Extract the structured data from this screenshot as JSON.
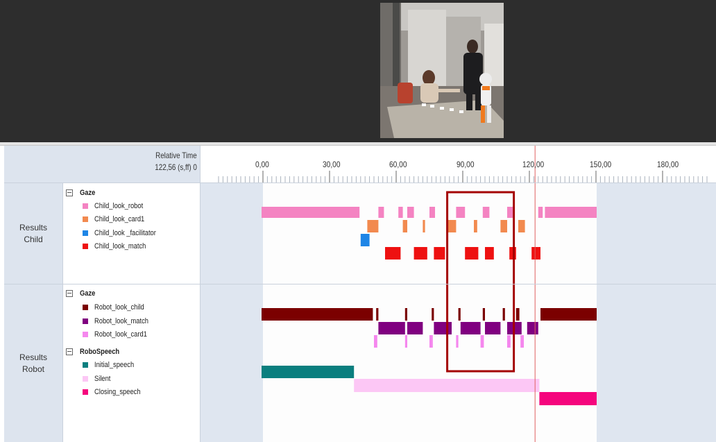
{
  "ruler": {
    "relative_time_label": "Relative Time",
    "time_format_label": "122,56 (s,ff) 0",
    "ticks": [
      "0,00",
      "30,00",
      "60,00",
      "90,00",
      "120,00",
      "150,00",
      "180,00"
    ]
  },
  "groups": [
    {
      "label_line1": "Results",
      "label_line2": "Child",
      "sections": [
        {
          "title": "Gaze",
          "tiers": [
            {
              "name": "Child_look_robot",
              "color": "#f483c2"
            },
            {
              "name": "Child_look_card1",
              "color": "#f28a4f"
            },
            {
              "name": "Child_look _facilitator",
              "color": "#1e85e6"
            },
            {
              "name": "Child_look_match",
              "color": "#ee1111"
            }
          ]
        }
      ]
    },
    {
      "label_line1": "Results",
      "label_line2": "Robot",
      "sections": [
        {
          "title": "Gaze",
          "tiers": [
            {
              "name": "Robot_look_child",
              "color": "#7b0000"
            },
            {
              "name": "Robot_look_match",
              "color": "#800080"
            },
            {
              "name": "Robot_look_card1",
              "color": "#f587ee"
            }
          ]
        },
        {
          "title": "RoboSpeech",
          "tiers": [
            {
              "name": "Initial_speech",
              "color": "#0a7f7f"
            },
            {
              "name": "Silent",
              "color": "#fcc7f5"
            },
            {
              "name": "Closing_speech",
              "color": "#f5057d"
            }
          ]
        }
      ]
    }
  ],
  "timeline": {
    "media_end": 150,
    "cursor_time": 122.56,
    "cursor_color": "#e06060",
    "highlight_range": [
      83,
      113
    ],
    "highlight_color": "#a40000"
  },
  "annotations": {
    "Child_look_robot": [
      [
        -1,
        43.5
      ],
      [
        52,
        54.5
      ],
      [
        61,
        63
      ],
      [
        65,
        68
      ],
      [
        75,
        77.5
      ],
      [
        87,
        91
      ],
      [
        99,
        102
      ],
      [
        110,
        112.5
      ],
      [
        124,
        126
      ],
      [
        127,
        151
      ]
    ],
    "Child_look_card1": [
      [
        47,
        52
      ],
      [
        63,
        65
      ],
      [
        72,
        73
      ],
      [
        83,
        87
      ],
      [
        95,
        96.5
      ],
      [
        107,
        110
      ],
      [
        115,
        118
      ]
    ],
    "Child_look _facilitator": [
      [
        44,
        48
      ]
    ],
    "Child_look_match": [
      [
        55,
        62
      ],
      [
        68,
        74
      ],
      [
        77,
        82
      ],
      [
        91,
        97
      ],
      [
        100,
        104
      ],
      [
        111,
        114
      ],
      [
        121,
        125
      ]
    ],
    "Robot_look_child": [
      [
        -1,
        49.5
      ],
      [
        51,
        52
      ],
      [
        64,
        65
      ],
      [
        76,
        77
      ],
      [
        88,
        89
      ],
      [
        99,
        100
      ],
      [
        108,
        109
      ],
      [
        114,
        115.5
      ],
      [
        125,
        151
      ]
    ],
    "Robot_look_match": [
      [
        52,
        64
      ],
      [
        65,
        72
      ],
      [
        77,
        85
      ],
      [
        89,
        98
      ],
      [
        100,
        107
      ],
      [
        110,
        116.5
      ],
      [
        119,
        124
      ]
    ],
    "Robot_look_card1": [
      [
        50,
        51.5
      ],
      [
        64,
        65
      ],
      [
        75,
        76.5
      ],
      [
        87,
        88
      ],
      [
        98,
        99.5
      ],
      [
        110,
        111.5
      ],
      [
        116,
        117.5
      ]
    ],
    "Initial_speech": [
      [
        -1,
        41
      ]
    ],
    "Silent": [
      [
        41,
        124.5
      ]
    ],
    "Closing_speech": [
      [
        124.5,
        151
      ]
    ]
  }
}
